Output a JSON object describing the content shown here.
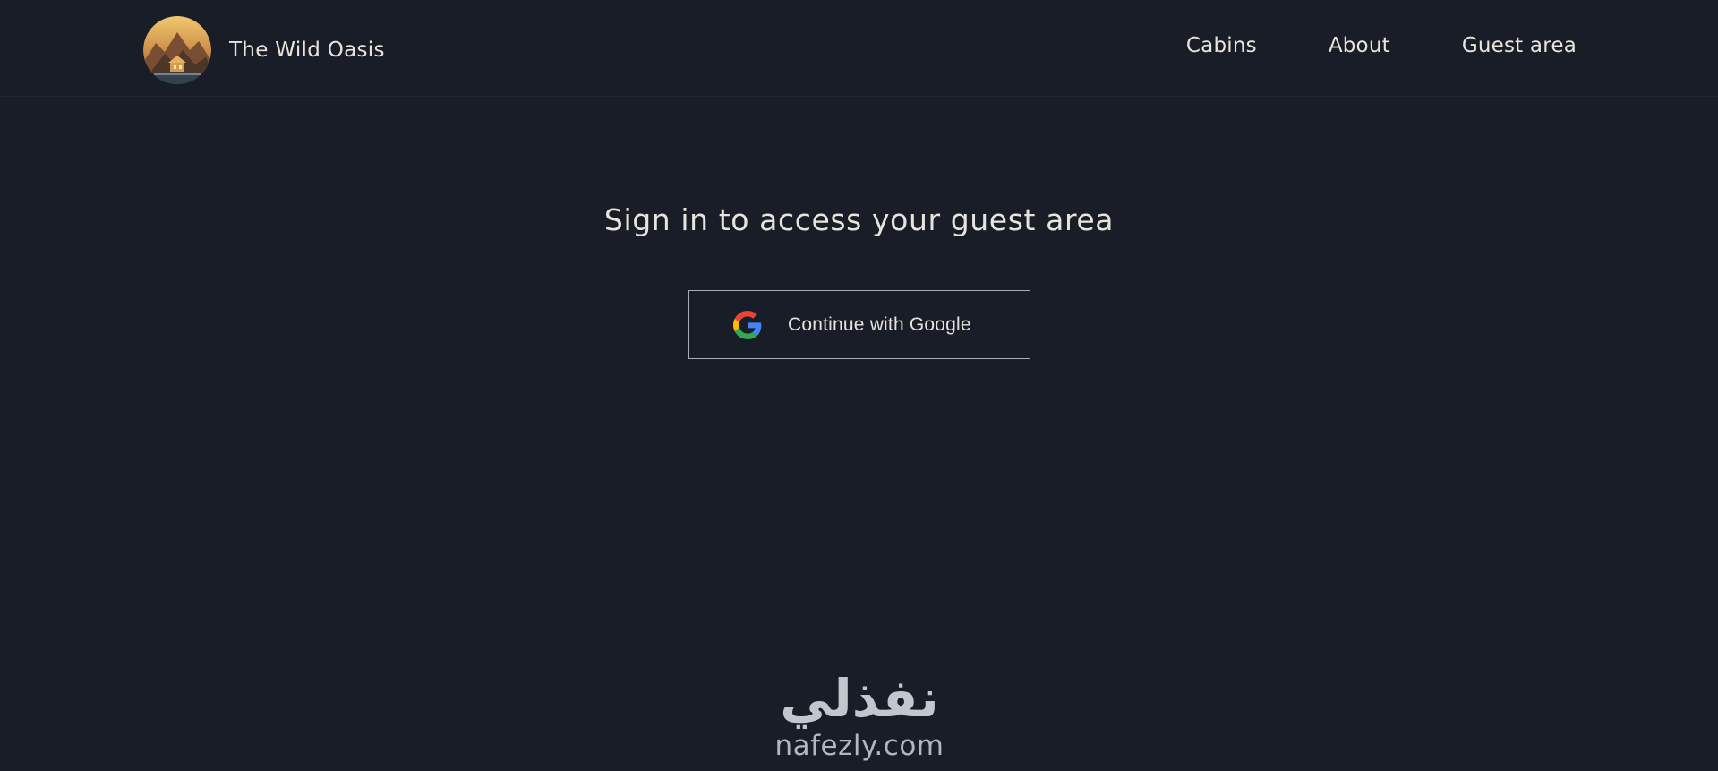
{
  "header": {
    "brand_name": "The Wild Oasis",
    "logo_icon": "cabin-mountain-logo",
    "nav": [
      {
        "label": "Cabins"
      },
      {
        "label": "About"
      },
      {
        "label": "Guest area"
      }
    ]
  },
  "main": {
    "title": "Sign in to access your guest area",
    "google_button": {
      "label": "Continue with Google",
      "icon": "google-icon"
    }
  },
  "watermark": {
    "arabic_text": "نفذلي",
    "latin_text": "nafezly.com"
  },
  "colors": {
    "background": "#181d28",
    "text": "#e9e4dc",
    "button_border": "#a5adbb"
  }
}
